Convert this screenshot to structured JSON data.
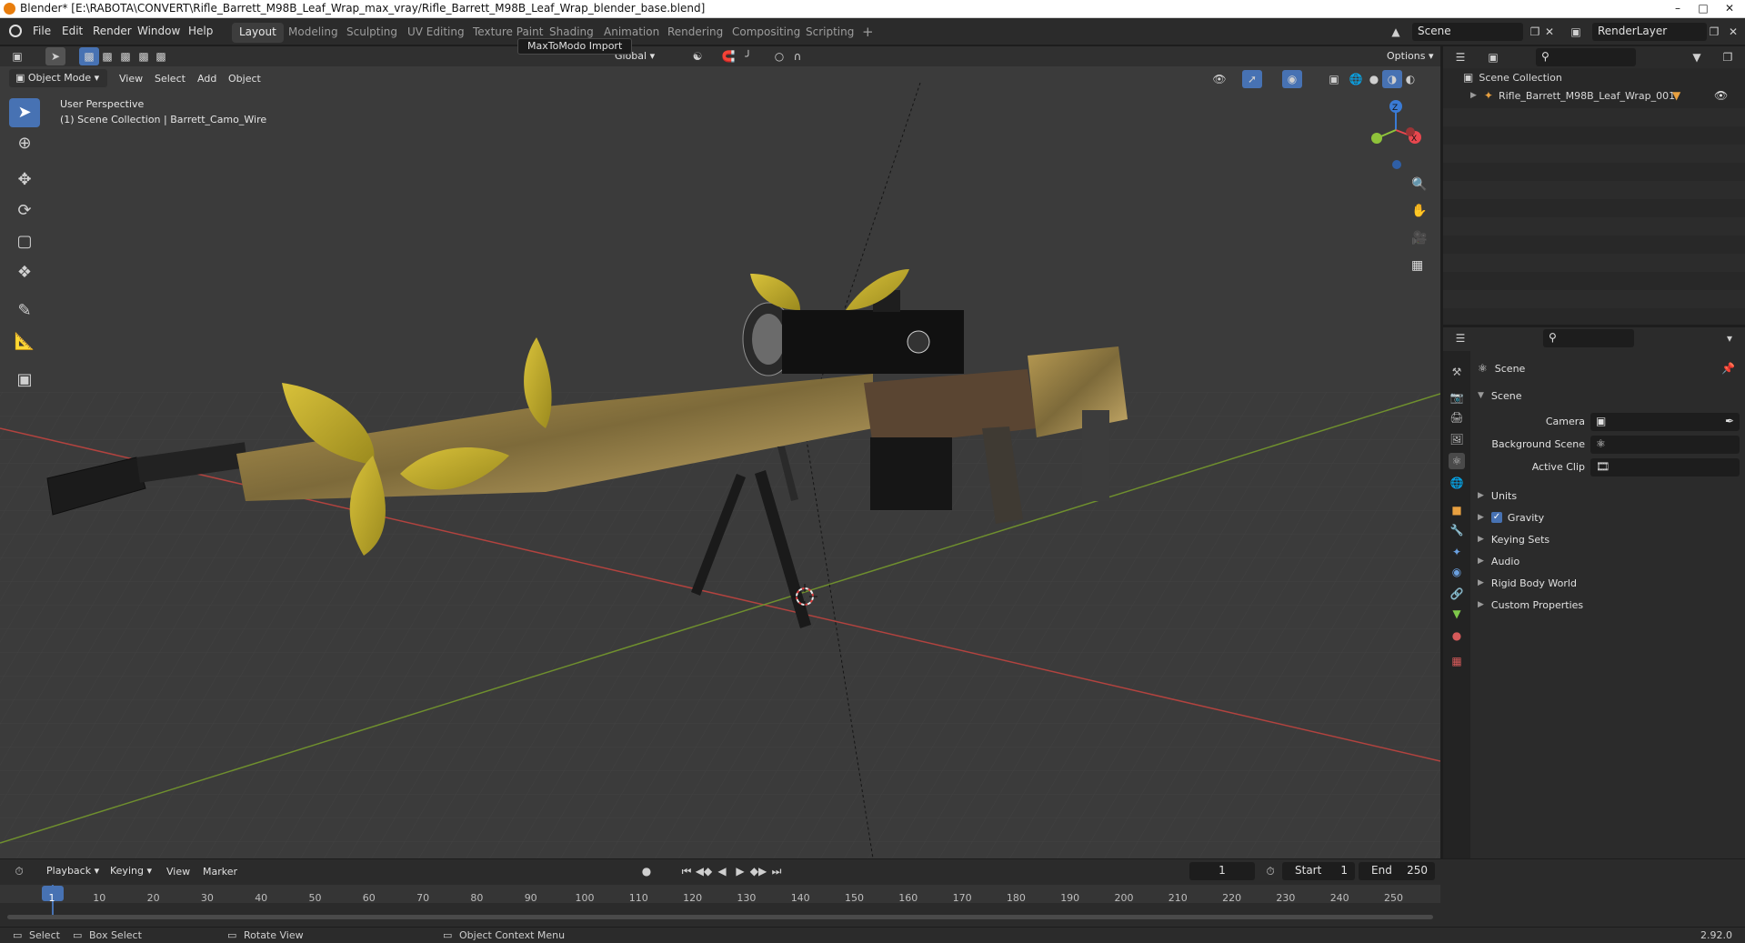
{
  "window": {
    "title": "Blender* [E:\\RABOTA\\CONVERT\\Rifle_Barrett_M98B_Leaf_Wrap_max_vray/Rifle_Barrett_M98B_Leaf_Wrap_blender_base.blend]",
    "min_label": "–",
    "max_label": "□",
    "close_label": "✕"
  },
  "menubar": {
    "items": [
      "File",
      "Edit",
      "Render",
      "Window",
      "Help"
    ]
  },
  "workspaces": {
    "tabs": [
      "Layout",
      "Modeling",
      "Sculpting",
      "UV Editing",
      "Texture Paint",
      "Shading",
      "Animation",
      "Rendering",
      "Compositing",
      "Scripting"
    ],
    "active": "Layout",
    "add_label": "+"
  },
  "tooltip": {
    "text": "MaxToModo Import"
  },
  "scene_selector": {
    "value": "Scene"
  },
  "renderlayer_selector": {
    "value": "RenderLayer"
  },
  "viewport_header": {
    "mode": "Object Mode",
    "menus": [
      "View",
      "Select",
      "Add",
      "Object"
    ],
    "orientation": "Global",
    "options_label": "Options"
  },
  "viewport": {
    "perspective_label": "User Perspective",
    "collection_label": "(1) Scene Collection | Barrett_Camo_Wire",
    "gizmo_axes": {
      "x": "X",
      "y": "Y",
      "z": "Z"
    }
  },
  "outliner": {
    "root": "Scene Collection",
    "items": [
      "Rifle_Barrett_M98B_Leaf_Wrap_001"
    ]
  },
  "properties": {
    "context": "Scene",
    "section": "Scene",
    "fields": [
      {
        "label": "Camera",
        "value": ""
      },
      {
        "label": "Background Scene",
        "value": ""
      },
      {
        "label": "Active Clip",
        "value": ""
      }
    ],
    "panels": [
      "Units",
      "Gravity",
      "Keying Sets",
      "Audio",
      "Rigid Body World",
      "Custom Properties"
    ],
    "gravity_checked": true
  },
  "timeline": {
    "menus": [
      "Playback",
      "Keying",
      "View",
      "Marker"
    ],
    "current_frame": "1",
    "start_label": "Start",
    "start": "1",
    "end_label": "End",
    "end": "250",
    "ticks": [
      "1",
      "10",
      "20",
      "30",
      "40",
      "50",
      "60",
      "70",
      "80",
      "90",
      "100",
      "110",
      "120",
      "130",
      "140",
      "150",
      "160",
      "170",
      "180",
      "190",
      "200",
      "210",
      "220",
      "230",
      "240",
      "250"
    ]
  },
  "statusbar": {
    "items": [
      "Select",
      "Box Select",
      "Rotate View",
      "Object Context Menu"
    ],
    "version": "2.92.0"
  },
  "colors": {
    "accent": "#4772b3",
    "x_axis": "#e8474e",
    "y_axis": "#8fc33a",
    "z_axis": "#3a7bd5",
    "frame_marker": "#4772b3"
  }
}
